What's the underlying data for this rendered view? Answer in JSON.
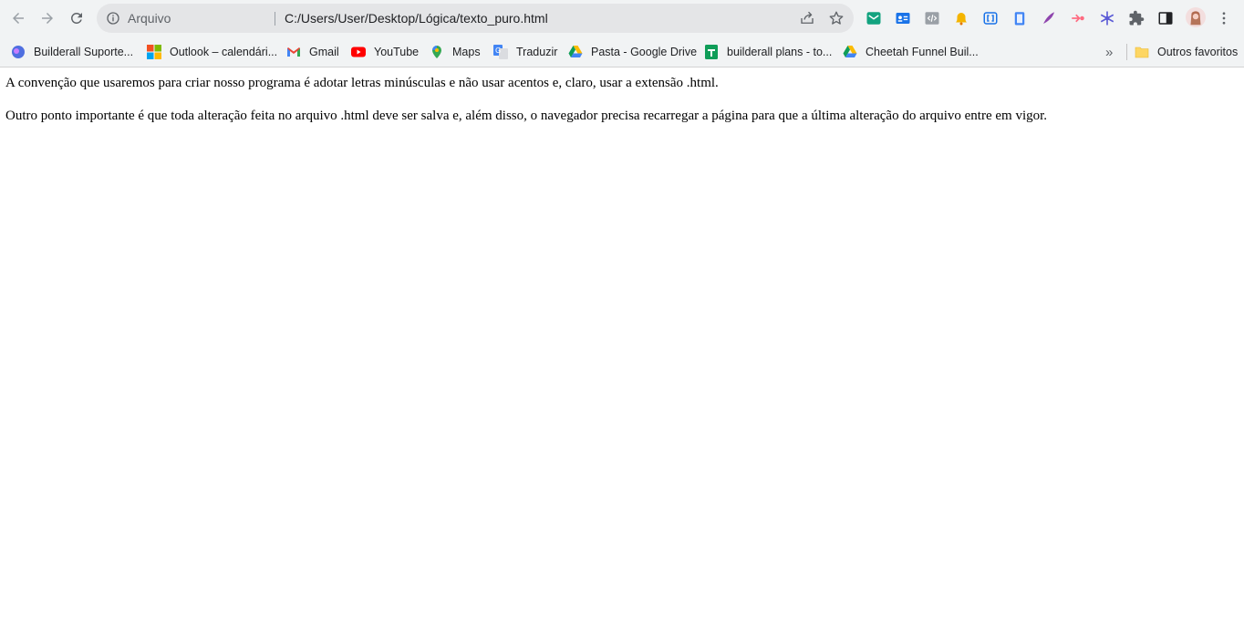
{
  "toolbar": {
    "back_icon": "arrow-left-icon",
    "forward_icon": "arrow-right-icon",
    "reload_icon": "reload-icon"
  },
  "omnibox": {
    "scheme_label": "Arquivo",
    "url": "C:/Users/User/Desktop/Lógica/texto_puro.html",
    "share_icon": "share-icon",
    "bookmark_icon": "star-icon"
  },
  "extensions": [
    {
      "icon": "mail-extension-icon",
      "color": "#12a37f"
    },
    {
      "icon": "contact-card-extension-icon",
      "color": "#1a73e8"
    },
    {
      "icon": "code-extension-icon",
      "color": "#9aa0a6"
    },
    {
      "icon": "bell-extension-icon",
      "color": "#f4b400"
    },
    {
      "icon": "bracket-extension-icon",
      "color": "#1a73e8"
    },
    {
      "icon": "clipboard-extension-icon",
      "color": "#4285f4"
    },
    {
      "icon": "feather-extension-icon",
      "color": "#8e44ad"
    },
    {
      "icon": "arrows-extension-icon",
      "color": "#ff6b81"
    },
    {
      "icon": "snowflake-extension-icon",
      "color": "#5b5bd6"
    },
    {
      "icon": "puzzle-icon",
      "color": "#5f6368"
    },
    {
      "icon": "side-panel-icon",
      "color": "#202124"
    },
    {
      "icon": "profile-avatar",
      "color": "#e8b4b8"
    },
    {
      "icon": "kebab-menu-icon",
      "color": "#5f6368"
    }
  ],
  "bookmarks": [
    {
      "label": "Builderall Suporte...",
      "icon": "builderall-icon"
    },
    {
      "label": "Outlook – calendári...",
      "icon": "microsoft-icon"
    },
    {
      "label": "Gmail",
      "icon": "gmail-icon"
    },
    {
      "label": "YouTube",
      "icon": "youtube-icon"
    },
    {
      "label": "Maps",
      "icon": "maps-pin-icon"
    },
    {
      "label": "Traduzir",
      "icon": "translate-icon"
    },
    {
      "label": "Pasta - Google Drive",
      "icon": "google-drive-icon"
    },
    {
      "label": "builderall plans - to...",
      "icon": "sheets-icon"
    },
    {
      "label": "Cheetah Funnel Buil...",
      "icon": "google-drive-icon"
    }
  ],
  "bookmarks_overflow": "»",
  "other_bookmarks": "Outros favoritos",
  "content": {
    "paragraph_1": "A convenção que usaremos para criar nosso programa é adotar letras minúsculas e não usar acentos e, claro, usar a extensão .html.",
    "paragraph_2": "Outro ponto importante é que toda alteração feita no arquivo .html deve ser salva e, além disso, o navegador precisa recarregar a página para que a última alteração do arquivo entre em vigor."
  }
}
